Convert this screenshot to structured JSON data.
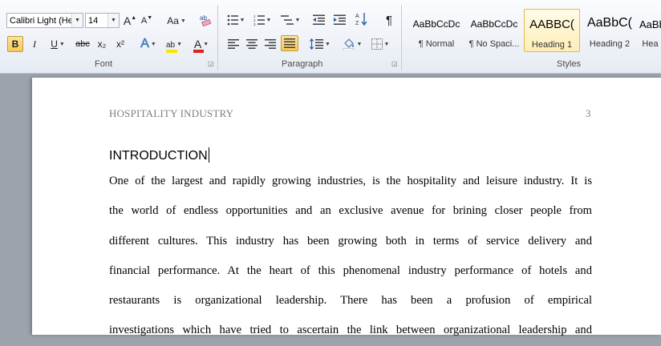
{
  "ribbon": {
    "font": {
      "label": "Font",
      "font_name": "Calibri Light (He",
      "font_size": "14",
      "grow_glyph": "A",
      "shrink_glyph": "A",
      "change_case": "Aa",
      "bold": "B",
      "italic": "I",
      "underline": "U",
      "strike": "abc",
      "subscript": "x₂",
      "superscript": "x²",
      "text_effects": "A",
      "highlight": "ab",
      "font_color": "A"
    },
    "paragraph": {
      "label": "Paragraph",
      "show_marks": "¶"
    },
    "styles": {
      "label": "Styles",
      "items": [
        {
          "sample": "AaBbCcDc",
          "name": "¶ Normal"
        },
        {
          "sample": "AaBbCcDc",
          "name": "¶ No Spaci..."
        },
        {
          "sample": "AABBC(",
          "name": "Heading 1"
        },
        {
          "sample": "AaBbC(",
          "name": "Heading 2"
        },
        {
          "sample": "AaBb",
          "name": "Hea"
        }
      ]
    }
  },
  "document": {
    "header_title": "HOSPITALITY INDUSTRY",
    "page_number": "3",
    "heading": "INTRODUCTION",
    "lines": [
      "One of the largest and rapidly growing industries, is the hospitality and leisure industry. It is",
      "the world of endless opportunities and an exclusive avenue for brining closer people from",
      "different cultures. This industry has been growing both in terms of service delivery and",
      "financial performance. At the heart of this phenomenal industry performance of hotels and",
      "restaurants is organizational leadership. There has been a profusion of empirical",
      "investigations which have tried to ascertain the link between organizational leadership and"
    ]
  },
  "colors": {
    "highlight": "#f5e800",
    "font_color": "#e02020",
    "active_button": "#f8c95a"
  }
}
